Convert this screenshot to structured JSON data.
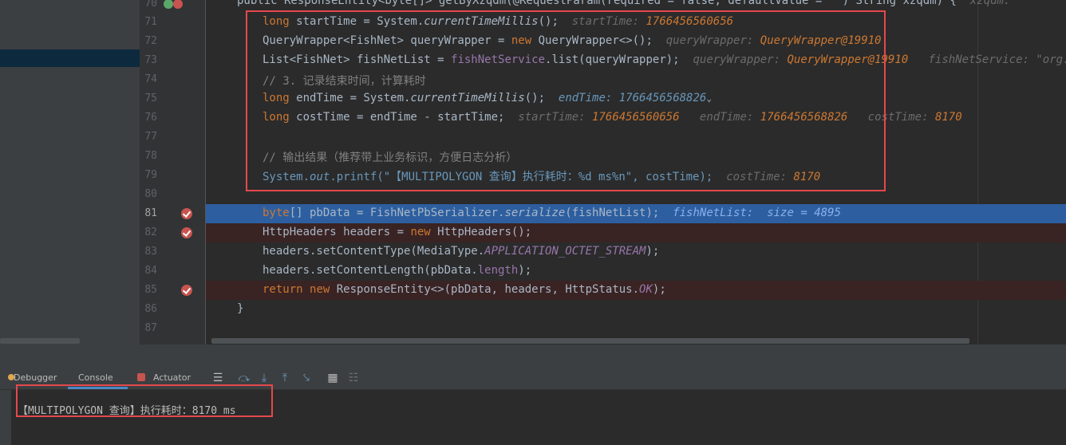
{
  "editor": {
    "partial_line_text": "public ResponseEntity<byte[]> getByXzqdm(@RequestParam(required = false, defaultValue = \"\") String xzqdm) {",
    "partial_line_hint": "xzqdm: \"\"",
    "lines": [
      {
        "num": "70"
      },
      {
        "num": "71"
      },
      {
        "num": "72"
      },
      {
        "num": "73"
      },
      {
        "num": "74"
      },
      {
        "num": "75"
      },
      {
        "num": "76"
      },
      {
        "num": "77"
      },
      {
        "num": "78"
      },
      {
        "num": "79"
      },
      {
        "num": "80"
      },
      {
        "num": "81"
      },
      {
        "num": "82"
      },
      {
        "num": "83"
      },
      {
        "num": "84"
      },
      {
        "num": "85"
      },
      {
        "num": "86"
      },
      {
        "num": "87"
      }
    ],
    "l71": {
      "kw": "long",
      "rest": " startTime = System.",
      "mtd": "currentTimeMillis",
      "end": "();",
      "hint_label": "startTime:",
      "hint_val": "1766456560656"
    },
    "l72": {
      "a": "QueryWrapper<FishNet> queryWrapper = ",
      "kw": "new",
      "b": " QueryWrapper<>();",
      "hint_label": "queryWrapper:",
      "hint_val": "QueryWrapper@19910"
    },
    "l73": {
      "a": "List<FishNet> fishNetList = ",
      "fld": "fishNetService",
      "b": ".list(queryWrapper);",
      "hint_label": "queryWrapper:",
      "hint_val": "QueryWrapper@19910",
      "hint2_label": "fishNetService:",
      "hint2_val": "\"org.jeecg"
    },
    "l74": {
      "cmt": "// 3. 记录结束时间，计算耗时"
    },
    "l75": {
      "kw": "long",
      "rest": " endTime = System.",
      "mtd": "currentTimeMillis",
      "end": "();",
      "hint_label": "endTime:",
      "hint_val": "1766456568826"
    },
    "l76": {
      "kw": "long",
      "rest": " costTime = endTime - startTime;",
      "h1l": "startTime:",
      "h1v": "1766456560656",
      "h2l": "endTime:",
      "h2v": "1766456568826",
      "h3l": "costTime:",
      "h3v": "8170"
    },
    "l78": {
      "cmt": "// 输出结果（推荐带上业务标识，方便日志分析）"
    },
    "l79": {
      "a": "System.",
      "fld": "out",
      "b": ".printf(",
      "str": "\"【MULTIPOLYGON 查询】执行耗时：%d ms%n\"",
      "c": ", costTime);",
      "hint_label": "costTime:",
      "hint_val": "8170"
    },
    "l81": {
      "kw": "byte",
      "a": "[] pbData = FishNetPbSerializer.",
      "mtd": "serialize",
      "b": "(fishNetList);",
      "hint_label": "fishNetList:",
      "hint_val": "size = 4895"
    },
    "l82": {
      "a": "HttpHeaders headers = ",
      "kw": "new",
      "b": " HttpHeaders();"
    },
    "l83": {
      "a": "headers.setContentType(MediaType.",
      "fld": "APPLICATION_OCTET_STREAM",
      "b": ");"
    },
    "l84": {
      "a": "headers.setContentLength(pbData.",
      "fld": "length",
      "b": ");"
    },
    "l85": {
      "kw": "return",
      "kw2": "new",
      "a": " ResponseEntity<>(pbData, headers, HttpStatus.",
      "fld": "OK",
      "b": ");"
    },
    "l86": {
      "a": "}"
    }
  },
  "toolbar": {
    "debugger_label": "Debugger",
    "console_label": "Console",
    "actuator_label": "Actuator"
  },
  "console": {
    "output": "【MULTIPOLYGON 查询】执行耗时：8170 ms"
  },
  "colors": {
    "breakpoint": "#c75450",
    "current_line": "#2d5fa0",
    "bp_line": "#3a2323",
    "highlight_box": "#e5484d"
  }
}
